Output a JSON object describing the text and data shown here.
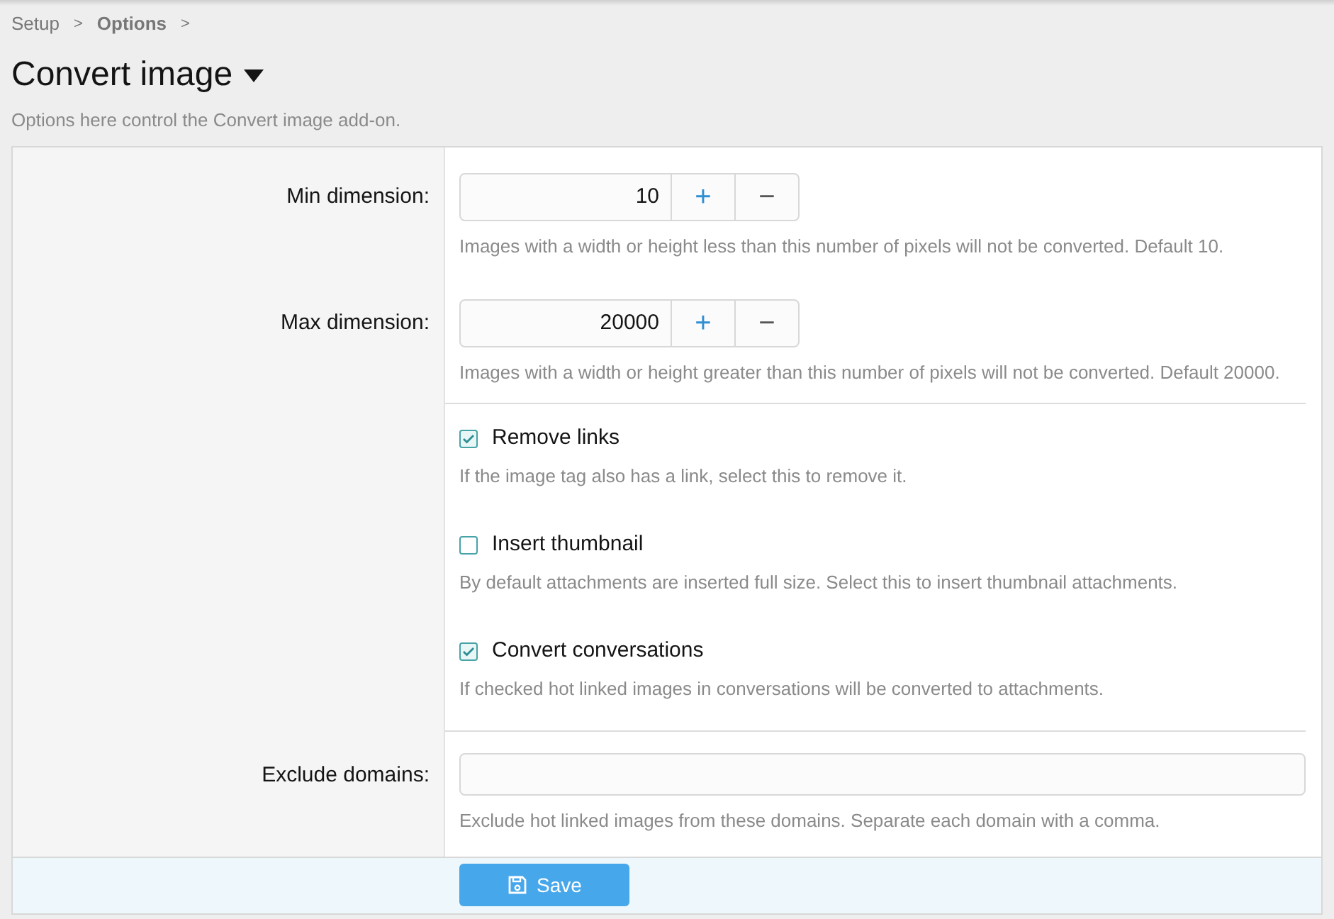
{
  "breadcrumb": [
    {
      "label": "Setup",
      "separator": ">"
    },
    {
      "label": "Options",
      "separator": ">"
    }
  ],
  "title": "Convert image",
  "description": "Options here control the Convert image add-on.",
  "sections": [
    {
      "rows": [
        {
          "kind": "number",
          "label": "Min dimension:",
          "value": "10",
          "plus": "+",
          "minus": "−",
          "hint": "Images with a width or height less than this number of pixels will not be converted. Default 10."
        },
        {
          "kind": "number",
          "label": "Max dimension:",
          "value": "20000",
          "plus": "+",
          "minus": "−",
          "hint": "Images with a width or height greater than this number of pixels will not be converted. Default 20000."
        }
      ]
    },
    {
      "rows": [
        {
          "kind": "checkbox",
          "label": "Remove links",
          "checked": true,
          "hint": "If the image tag also has a link, select this to remove it."
        },
        {
          "kind": "checkbox",
          "label": "Insert thumbnail",
          "checked": false,
          "hint": "By default attachments are inserted full size. Select this to insert thumbnail attachments."
        },
        {
          "kind": "checkbox",
          "label": "Convert conversations",
          "checked": true,
          "hint": "If checked hot linked images in conversations will be converted to attachments."
        }
      ]
    },
    {
      "rows": [
        {
          "kind": "text",
          "label": "Exclude domains:",
          "hint": "Exclude hot linked images from these domains. Separate each domain with a comma."
        }
      ]
    }
  ],
  "save_button": {
    "label": "Save"
  }
}
